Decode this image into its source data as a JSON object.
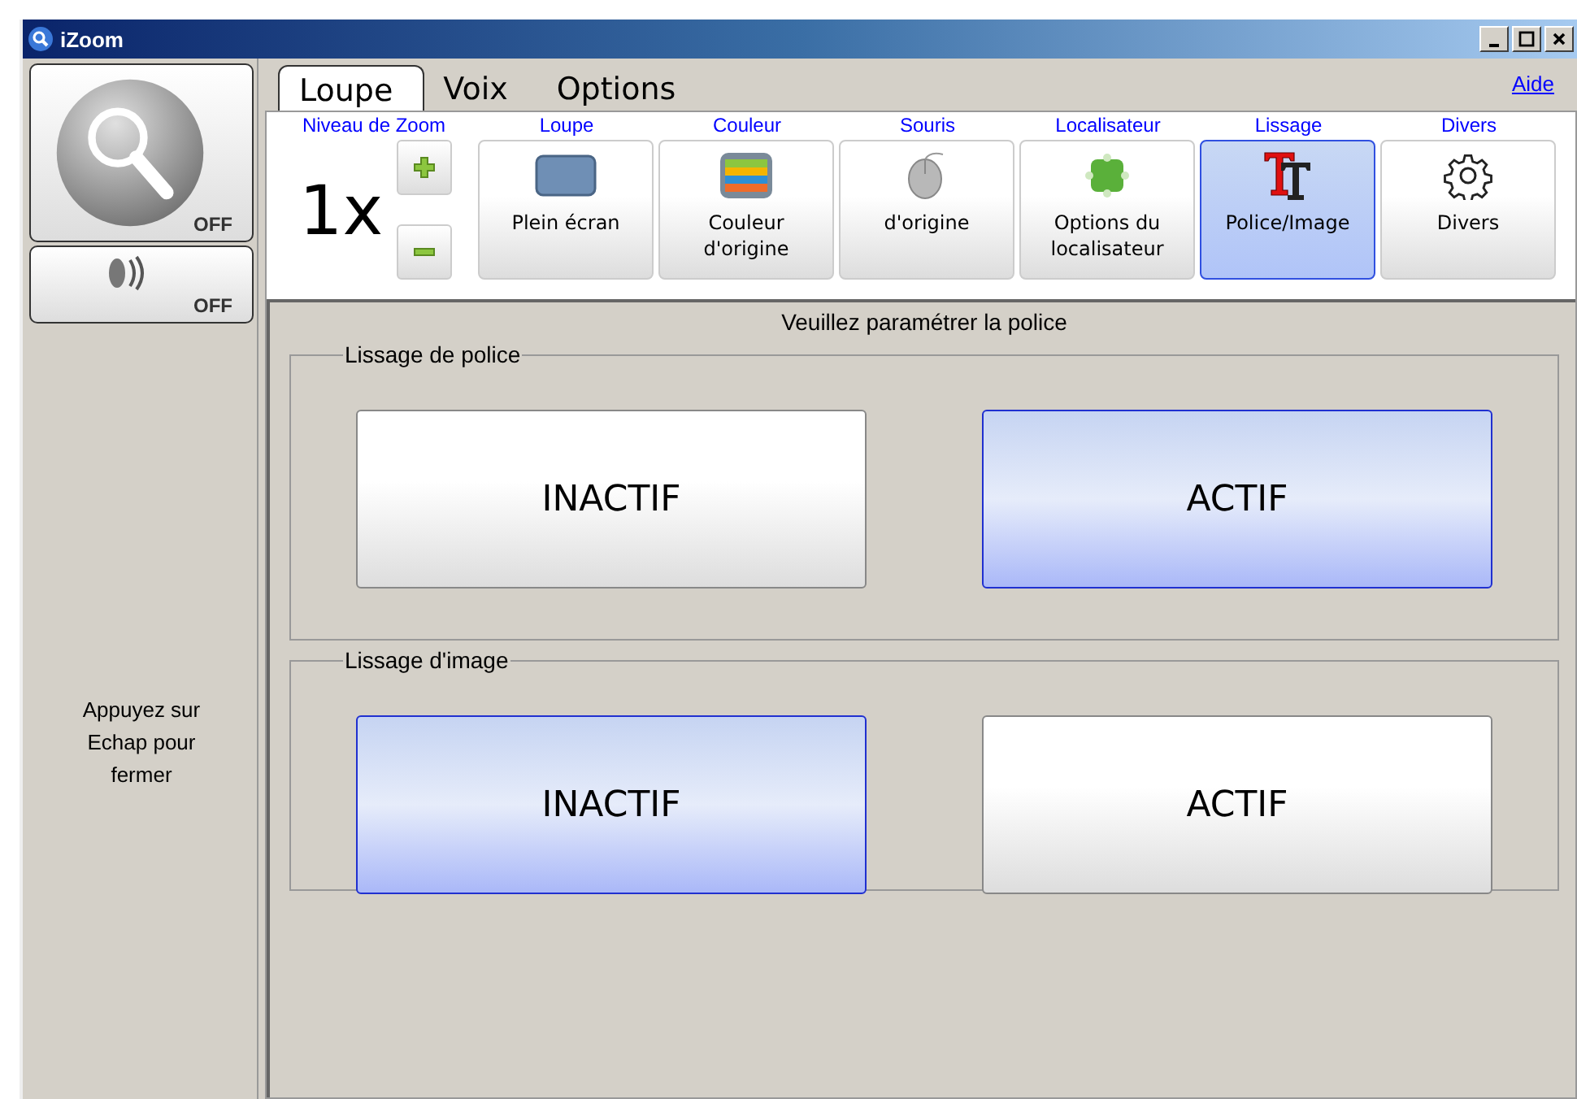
{
  "window": {
    "title": "iZoom"
  },
  "side": {
    "magnifier_state": "OFF",
    "speech_state": "OFF",
    "hint": "Appuyez sur Echap pour fermer"
  },
  "tabs": [
    {
      "label": "Loupe",
      "selected": true
    },
    {
      "label": "Voix",
      "selected": false
    },
    {
      "label": "Options",
      "selected": false
    }
  ],
  "help_link": "Aide",
  "zoom": {
    "heading": "Niveau de Zoom",
    "value": "1x"
  },
  "tools": [
    {
      "heading": "Loupe",
      "label": "Plein écran",
      "kind": "fullscreen",
      "selected": false
    },
    {
      "heading": "Couleur",
      "label": "Couleur d'origine",
      "kind": "color",
      "selected": false
    },
    {
      "heading": "Souris",
      "label": "d'origine",
      "kind": "mouse",
      "selected": false
    },
    {
      "heading": "Localisateur",
      "label": "Options du localisateur",
      "kind": "locator",
      "selected": false
    },
    {
      "heading": "Lissage",
      "label": "Police/Image",
      "kind": "font",
      "selected": true
    },
    {
      "heading": "Divers",
      "label": "Divers",
      "kind": "gear",
      "selected": false
    }
  ],
  "panel": {
    "title": "Veuillez paramétrer la police",
    "groups": [
      {
        "legend": "Lissage de police",
        "options": [
          {
            "label": "INACTIF",
            "selected": false
          },
          {
            "label": "ACTIF",
            "selected": true
          }
        ]
      },
      {
        "legend": "Lissage d'image",
        "options": [
          {
            "label": "INACTIF",
            "selected": true
          },
          {
            "label": "ACTIF",
            "selected": false
          }
        ]
      }
    ]
  }
}
